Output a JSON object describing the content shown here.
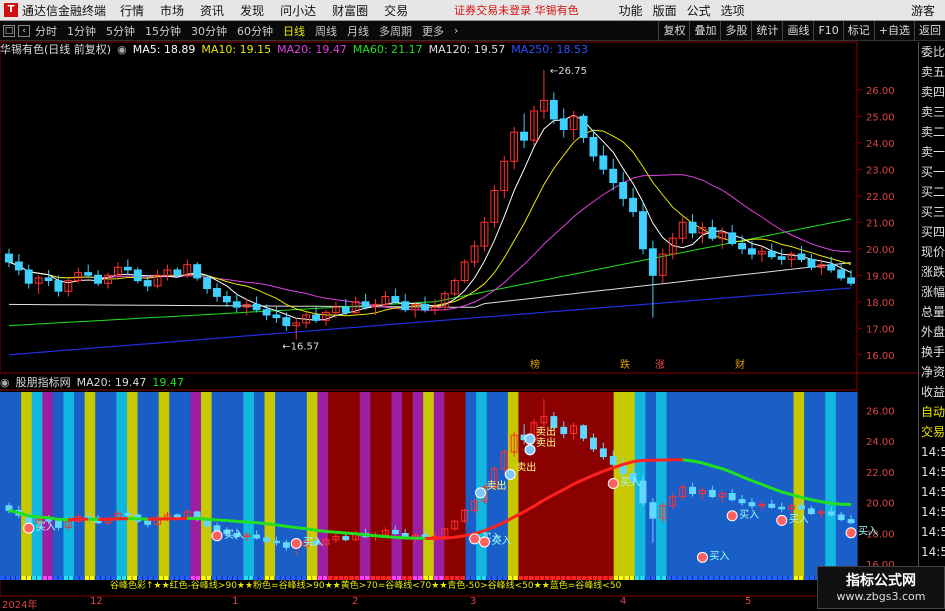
{
  "topbar": {
    "app_name": "通达信金融终端",
    "menus": [
      "行情",
      "市场",
      "资讯",
      "发现",
      "问小达",
      "财富圈",
      "交易"
    ],
    "notice": "证券交易未登录  华锡有色",
    "right_menus": [
      "功能",
      "版面",
      "公式",
      "选项"
    ],
    "guest": "游客"
  },
  "toolbar": {
    "periods": [
      "分时",
      "1分钟",
      "5分钟",
      "15分钟",
      "30分钟",
      "60分钟",
      "日线",
      "周线",
      "月线",
      "多周期",
      "更多"
    ],
    "active_period": "日线",
    "right_buttons": [
      "复权",
      "叠加",
      "多股",
      "统计",
      "画线",
      "F10",
      "标记",
      "+自选",
      "返回"
    ]
  },
  "main_chart": {
    "stock_title": "华锡有色(日线 前复权)",
    "ma_labels": [
      {
        "text": "MA5: 18.89",
        "color": "#ffffff"
      },
      {
        "text": "MA10: 19.15",
        "color": "#e8e800"
      },
      {
        "text": "MA20: 19.47",
        "color": "#e040e0"
      },
      {
        "text": "MA60: 21.17",
        "color": "#20e020"
      },
      {
        "text": "MA120: 19.57",
        "color": "#e0e0e0"
      },
      {
        "text": "MA250: 18.53",
        "color": "#3050ff"
      }
    ],
    "high_label": "26.75",
    "low_label": "16.57",
    "y_ticks": [
      "26.00",
      "25.00",
      "24.00",
      "23.00",
      "22.00",
      "21.00",
      "20.00",
      "19.00",
      "18.00",
      "17.00",
      "16.00"
    ],
    "event_markers": [
      {
        "text": "榜",
        "color": "#e0a000"
      },
      {
        "text": "跌",
        "color": "#e0a000"
      },
      {
        "text": "涨",
        "color": "#e05050"
      },
      {
        "text": "财",
        "color": "#e0a000"
      }
    ]
  },
  "sub_chart": {
    "indicator_name": "股朋指标网",
    "ma_label": "MA20: 19.47",
    "ma_value": "19.47",
    "y_ticks": [
      "26.00",
      "24.00",
      "22.00",
      "20.00",
      "18.00",
      "16.00"
    ],
    "buy_label": "买入",
    "sell_label": "卖出",
    "legend_text": "谷峰色彩↑★★红色-谷峰线>90★★粉色=谷峰线>90★★黄色>70=谷峰线<70★★青色-50>谷峰线<50★★蓝色=谷峰线<50"
  },
  "x_axis": [
    "2024年",
    "12",
    "1",
    "2",
    "3",
    "4",
    "5"
  ],
  "right_panel": [
    "委比",
    "卖五",
    "卖四",
    "卖三",
    "卖二",
    "卖一",
    "买一",
    "买二",
    "买三",
    "买四",
    "现价",
    "涨跌",
    "涨幅",
    "总量",
    "外盘",
    "换手",
    "净资",
    "收益",
    "自动",
    "交易",
    "14:55",
    "14:55",
    "14:55",
    "14:55",
    "14:55",
    "14:55",
    "14:55",
    "14:56"
  ],
  "watermark": {
    "line1": "指标公式网",
    "line2": "www.zbgs3.com"
  },
  "chart_data": {
    "type": "candlestick",
    "x_axis_labels": [
      "2024年",
      "12",
      "1",
      "2",
      "3",
      "4",
      "5"
    ],
    "ohlc": [
      [
        19.8,
        20.0,
        19.3,
        19.5
      ],
      [
        19.5,
        19.8,
        19.0,
        19.2
      ],
      [
        19.2,
        19.4,
        18.5,
        18.7
      ],
      [
        18.7,
        19.0,
        18.3,
        18.9
      ],
      [
        18.9,
        19.2,
        18.6,
        18.8
      ],
      [
        18.8,
        19.0,
        18.2,
        18.4
      ],
      [
        18.4,
        18.9,
        18.2,
        18.8
      ],
      [
        18.8,
        19.3,
        18.7,
        19.1
      ],
      [
        19.1,
        19.4,
        18.9,
        19.0
      ],
      [
        19.0,
        19.2,
        18.6,
        18.7
      ],
      [
        18.7,
        19.1,
        18.5,
        19.0
      ],
      [
        19.0,
        19.5,
        18.9,
        19.3
      ],
      [
        19.3,
        19.6,
        19.0,
        19.2
      ],
      [
        19.2,
        19.3,
        18.7,
        18.8
      ],
      [
        18.8,
        19.0,
        18.4,
        18.6
      ],
      [
        18.6,
        19.2,
        18.5,
        19.0
      ],
      [
        19.0,
        19.4,
        18.8,
        19.2
      ],
      [
        19.2,
        19.3,
        18.9,
        19.0
      ],
      [
        19.0,
        19.6,
        18.9,
        19.4
      ],
      [
        19.4,
        19.5,
        18.8,
        18.9
      ],
      [
        18.9,
        19.0,
        18.3,
        18.5
      ],
      [
        18.5,
        18.7,
        18.0,
        18.2
      ],
      [
        18.2,
        18.4,
        17.8,
        18.0
      ],
      [
        18.0,
        18.3,
        17.6,
        17.8
      ],
      [
        17.8,
        18.1,
        17.5,
        17.9
      ],
      [
        17.9,
        18.2,
        17.6,
        17.7
      ],
      [
        17.7,
        17.9,
        17.3,
        17.5
      ],
      [
        17.5,
        17.8,
        17.2,
        17.4
      ],
      [
        17.4,
        17.6,
        16.9,
        17.1
      ],
      [
        17.1,
        17.4,
        16.57,
        17.2
      ],
      [
        17.2,
        17.6,
        17.0,
        17.5
      ],
      [
        17.5,
        17.8,
        17.2,
        17.3
      ],
      [
        17.3,
        17.7,
        17.1,
        17.6
      ],
      [
        17.6,
        18.0,
        17.4,
        17.8
      ],
      [
        17.8,
        18.1,
        17.5,
        17.6
      ],
      [
        17.6,
        18.2,
        17.5,
        18.0
      ],
      [
        18.0,
        18.3,
        17.7,
        17.8
      ],
      [
        17.8,
        18.1,
        17.5,
        17.9
      ],
      [
        17.9,
        18.4,
        17.8,
        18.2
      ],
      [
        18.2,
        18.5,
        17.9,
        18.0
      ],
      [
        18.0,
        18.3,
        17.6,
        17.7
      ],
      [
        17.7,
        18.0,
        17.4,
        17.9
      ],
      [
        17.9,
        18.2,
        17.6,
        17.7
      ],
      [
        17.7,
        18.1,
        17.5,
        17.8
      ],
      [
        17.8,
        18.4,
        17.7,
        18.3
      ],
      [
        18.3,
        18.9,
        18.2,
        18.8
      ],
      [
        18.8,
        19.6,
        18.7,
        19.5
      ],
      [
        19.5,
        20.3,
        19.3,
        20.1
      ],
      [
        20.1,
        21.2,
        19.9,
        21.0
      ],
      [
        21.0,
        22.4,
        20.8,
        22.2
      ],
      [
        22.2,
        23.5,
        21.9,
        23.3
      ],
      [
        23.3,
        24.6,
        23.0,
        24.4
      ],
      [
        24.4,
        25.1,
        23.8,
        24.1
      ],
      [
        24.1,
        25.4,
        23.9,
        25.2
      ],
      [
        25.2,
        26.75,
        24.9,
        25.6
      ],
      [
        25.6,
        25.9,
        24.7,
        24.9
      ],
      [
        24.9,
        25.3,
        24.2,
        24.5
      ],
      [
        24.5,
        25.2,
        24.1,
        25.0
      ],
      [
        25.0,
        25.1,
        24.0,
        24.2
      ],
      [
        24.2,
        24.5,
        23.3,
        23.5
      ],
      [
        23.5,
        23.9,
        22.8,
        23.0
      ],
      [
        23.0,
        23.4,
        22.2,
        22.5
      ],
      [
        22.5,
        22.9,
        21.6,
        21.9
      ],
      [
        21.9,
        22.3,
        21.2,
        21.4
      ],
      [
        21.4,
        21.8,
        19.8,
        20.0
      ],
      [
        20.0,
        20.3,
        17.4,
        19.0
      ],
      [
        19.0,
        20.0,
        18.7,
        19.8
      ],
      [
        19.8,
        20.6,
        19.6,
        20.4
      ],
      [
        20.4,
        21.2,
        20.2,
        21.0
      ],
      [
        21.0,
        21.3,
        20.4,
        20.6
      ],
      [
        20.6,
        21.0,
        20.2,
        20.8
      ],
      [
        20.8,
        21.1,
        20.3,
        20.4
      ],
      [
        20.4,
        20.8,
        20.0,
        20.6
      ],
      [
        20.6,
        20.9,
        20.1,
        20.2
      ],
      [
        20.2,
        20.5,
        19.8,
        20.0
      ],
      [
        20.0,
        20.3,
        19.6,
        19.8
      ],
      [
        19.8,
        20.1,
        19.5,
        19.9
      ],
      [
        19.9,
        20.2,
        19.6,
        19.7
      ],
      [
        19.7,
        20.0,
        19.4,
        19.6
      ],
      [
        19.6,
        19.9,
        19.3,
        19.8
      ],
      [
        19.8,
        20.1,
        19.5,
        19.6
      ],
      [
        19.6,
        19.8,
        19.2,
        19.3
      ],
      [
        19.3,
        19.6,
        19.0,
        19.4
      ],
      [
        19.4,
        19.7,
        19.1,
        19.2
      ],
      [
        19.2,
        19.4,
        18.8,
        18.9
      ],
      [
        18.9,
        19.2,
        18.6,
        18.7
      ]
    ],
    "ma5_last": 18.89,
    "ma10_last": 19.15,
    "ma20_last": 19.47,
    "ma60_last": 21.17,
    "ma120_last": 19.57,
    "ma250_last": 18.53,
    "ylim": [
      15.5,
      27.2
    ],
    "colors": {
      "up": "#ff3030",
      "down": "#40d0ff",
      "ma5": "#ffffff",
      "ma10": "#e8e800",
      "ma20": "#e040e0",
      "ma60": "#20e020",
      "ma120": "#e0e0e0",
      "ma250": "#2030e0"
    }
  }
}
